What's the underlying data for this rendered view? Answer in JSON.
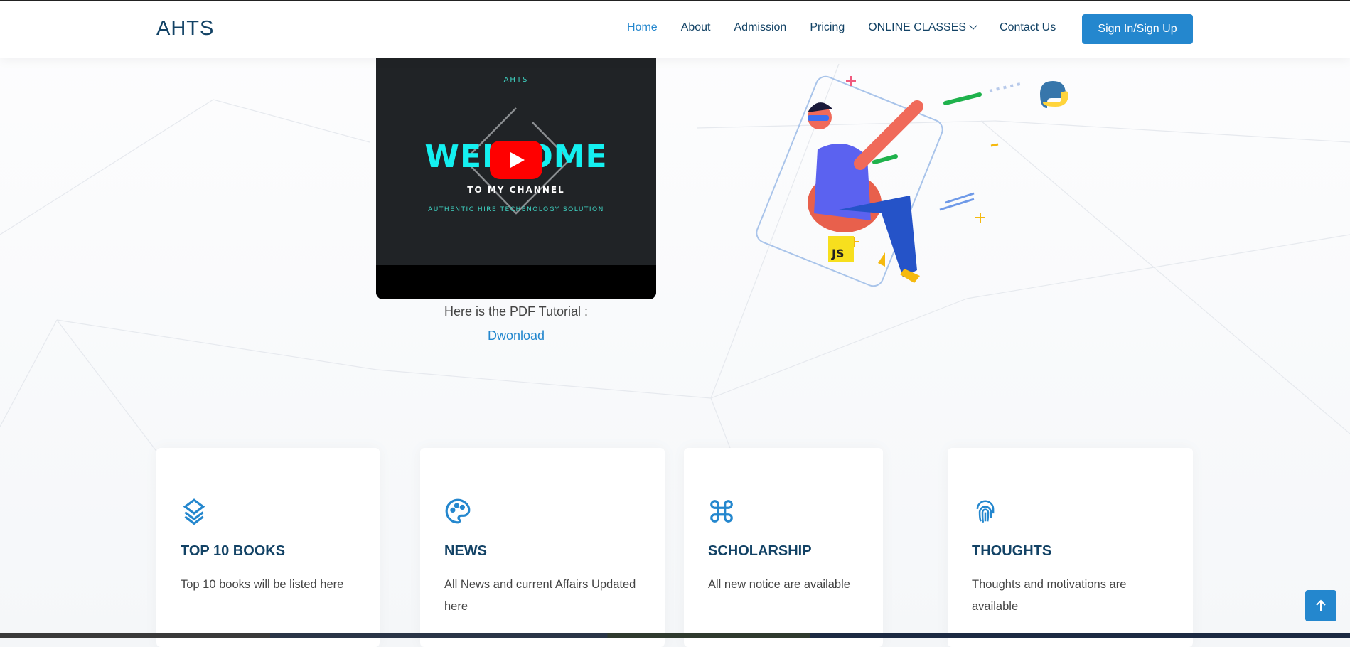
{
  "header": {
    "logo": "AHTS",
    "nav": [
      {
        "label": "Home"
      },
      {
        "label": "About"
      },
      {
        "label": "Admission"
      },
      {
        "label": "Pricing"
      },
      {
        "label": "ONLINE CLASSES"
      },
      {
        "label": "Contact Us"
      }
    ],
    "signin": "Sign In/Sign Up"
  },
  "video": {
    "brand": "AHTS",
    "headline": "WELCOME",
    "line2": "TO MY CHANNEL",
    "line3": "AUTHENTIC HIRE TECHENOLOGY SOLUTION"
  },
  "pdf": {
    "text": "Here is the PDF Tutorial :",
    "link": "Dwonload"
  },
  "illustration": {
    "badge": "JS"
  },
  "cards": [
    {
      "icon": "layers-icon",
      "title": "TOP 10 BOOKS",
      "text": "Top 10 books will be listed here"
    },
    {
      "icon": "palette-icon",
      "title": "NEWS",
      "text": "All News and current Affairs Updated here"
    },
    {
      "icon": "command-icon",
      "title": "SCHOLARSHIP",
      "text": "All new notice are available"
    },
    {
      "icon": "fingerprint-icon",
      "title": "THOUGHTS",
      "text": "Thoughts and motivations are available"
    }
  ],
  "colors": {
    "accent": "#2487ce",
    "heading": "#124265"
  }
}
